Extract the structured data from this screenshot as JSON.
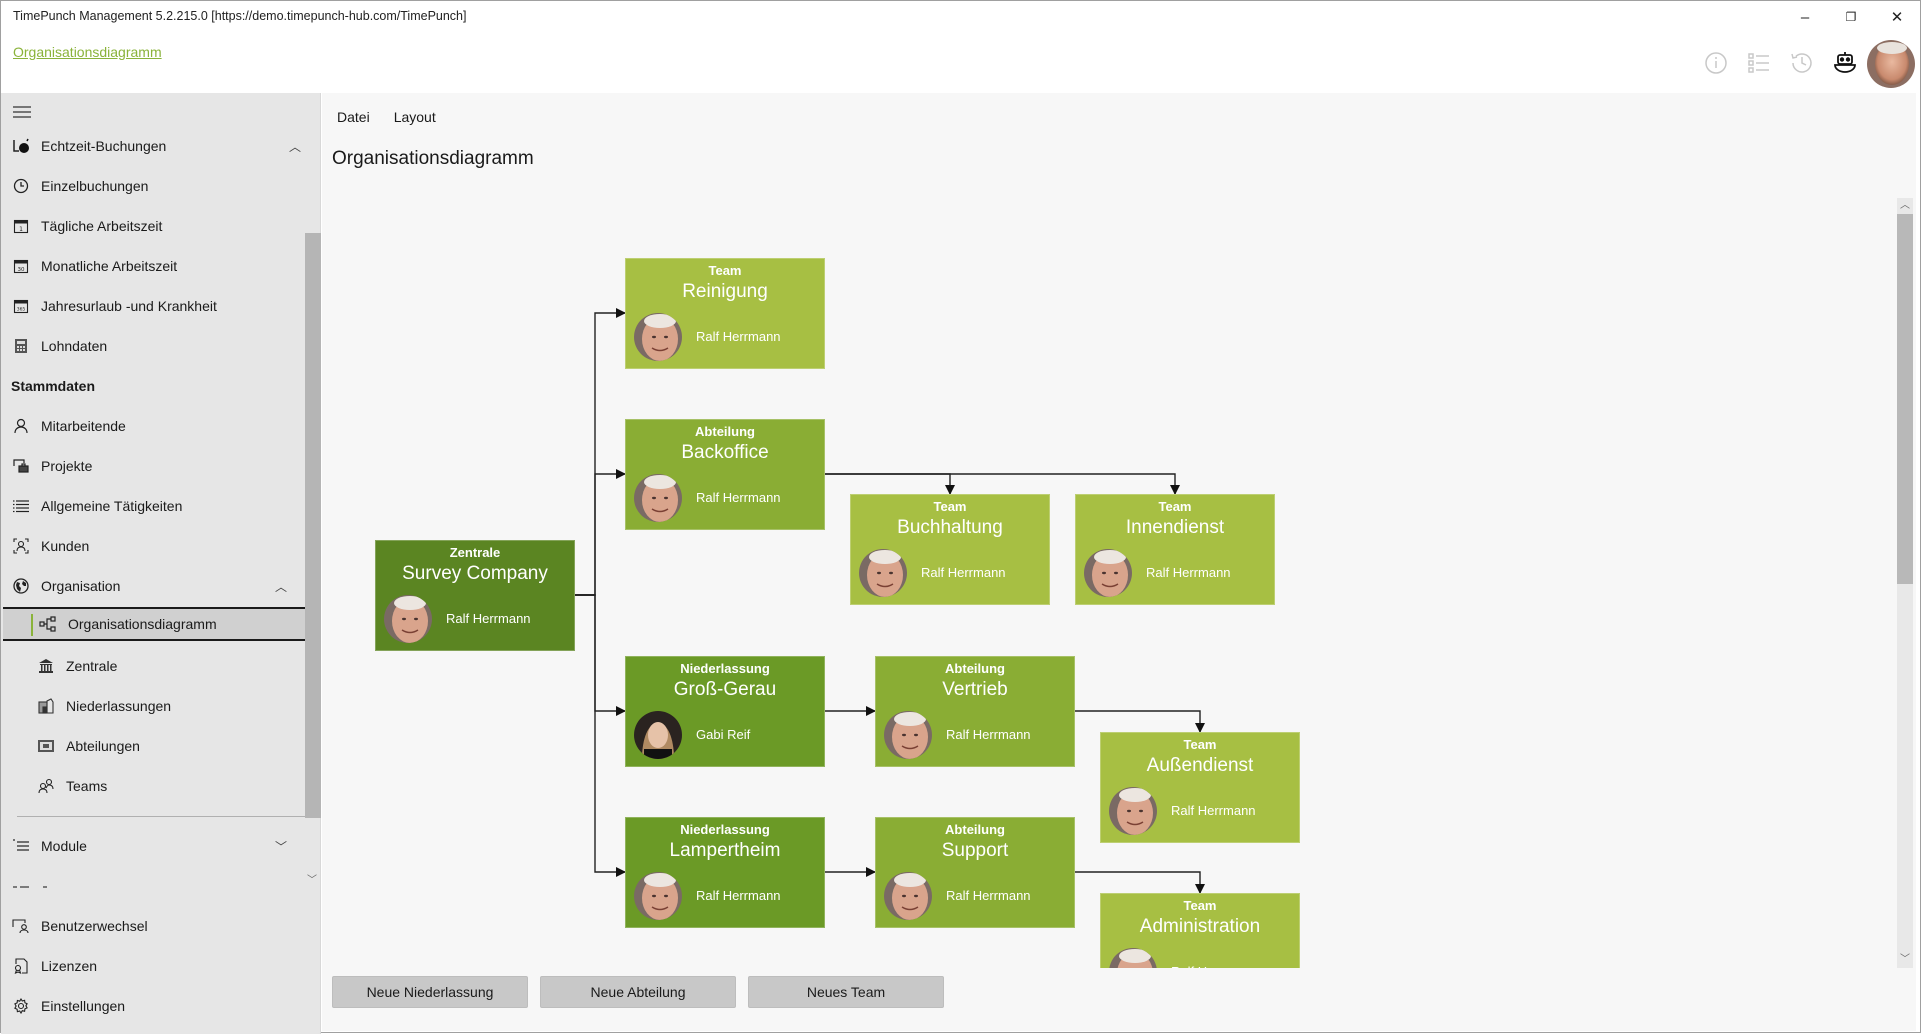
{
  "window": {
    "title": "TimePunch Management 5.2.215.0 [https://demo.timepunch-hub.com/TimePunch]",
    "controls": {
      "minimize": "–",
      "restore": "❐",
      "close": "✕"
    }
  },
  "header": {
    "breadcrumb": "Organisationsdiagramm",
    "accent_color": "#8ab33a",
    "icons": [
      "info-icon",
      "list-icon",
      "history-icon",
      "bot-icon",
      "user-avatar"
    ]
  },
  "sidebar": {
    "menu_icon": "hamburger-icon",
    "items": [
      {
        "label": "Echtzeit-Buchungen",
        "icon": "realtime-booking-icon",
        "chevron": "up"
      },
      {
        "label": "Einzelbuchungen",
        "icon": "clock-icon"
      },
      {
        "label": "Tägliche Arbeitszeit",
        "icon": "calendar-day-icon",
        "icon_text": "1"
      },
      {
        "label": "Monatliche Arbeitszeit",
        "icon": "calendar-month-icon",
        "icon_text": "30"
      },
      {
        "label": "Jahresurlaub -und Krankheit",
        "icon": "calendar-year-icon",
        "icon_text": "365"
      },
      {
        "label": "Lohndaten",
        "icon": "calculator-icon"
      }
    ],
    "section_stammdaten": "Stammdaten",
    "stammdaten_items": [
      {
        "label": "Mitarbeitende",
        "icon": "person-icon"
      },
      {
        "label": "Projekte",
        "icon": "projects-icon"
      },
      {
        "label": "Allgemeine Tätigkeiten",
        "icon": "list-icon"
      },
      {
        "label": "Kunden",
        "icon": "customer-icon"
      },
      {
        "label": "Organisation",
        "icon": "globe-icon",
        "chevron": "up"
      }
    ],
    "organisation_sub": [
      {
        "label": "Organisationsdiagramm",
        "icon": "org-chart-icon",
        "active": true
      },
      {
        "label": "Zentrale",
        "icon": "bank-icon"
      },
      {
        "label": "Niederlassungen",
        "icon": "building-icon"
      },
      {
        "label": "Abteilungen",
        "icon": "department-icon"
      },
      {
        "label": "Teams",
        "icon": "team-icon"
      }
    ],
    "module": {
      "label": "Module",
      "icon": "module-list-icon",
      "chevron": "down"
    },
    "bottom_items": [
      {
        "label": "Benutzerwechsel",
        "icon": "switch-user-icon"
      },
      {
        "label": "Lizenzen",
        "icon": "license-icon"
      },
      {
        "label": "Einstellungen",
        "icon": "gear-icon"
      }
    ]
  },
  "main": {
    "menu": [
      "Datei",
      "Layout"
    ],
    "title": "Organisationsdiagramm",
    "buttons": [
      "Neue Niederlassung",
      "Neue Abteilung",
      "Neues Team"
    ]
  },
  "orgchart": {
    "colors": {
      "zentrale": "#5b8522",
      "niederlassung": "#6b9a26",
      "abteilung": "#8aad34",
      "team": "#a7bf43"
    },
    "nodes": [
      {
        "id": "survey",
        "type": "Zentrale",
        "name": "Survey Company",
        "person": "Ralf Herrmann",
        "level": 0
      },
      {
        "id": "reinigung",
        "type": "Team",
        "name": "Reinigung",
        "person": "Ralf Herrmann",
        "level": 3,
        "parent": "survey"
      },
      {
        "id": "backoffice",
        "type": "Abteilung",
        "name": "Backoffice",
        "person": "Ralf Herrmann",
        "level": 2,
        "parent": "survey"
      },
      {
        "id": "buchhaltung",
        "type": "Team",
        "name": "Buchhaltung",
        "person": "Ralf Herrmann",
        "level": 3,
        "parent": "backoffice"
      },
      {
        "id": "innendienst",
        "type": "Team",
        "name": "Innendienst",
        "person": "Ralf Herrmann",
        "level": 3,
        "parent": "backoffice"
      },
      {
        "id": "grossgerau",
        "type": "Niederlassung",
        "name": "Groß-Gerau",
        "person": "Gabi Reif",
        "level": 1,
        "parent": "survey"
      },
      {
        "id": "vertrieb",
        "type": "Abteilung",
        "name": "Vertrieb",
        "person": "Ralf Herrmann",
        "level": 2,
        "parent": "grossgerau"
      },
      {
        "id": "aussendienst",
        "type": "Team",
        "name": "Außendienst",
        "person": "Ralf Herrmann",
        "level": 3,
        "parent": "vertrieb"
      },
      {
        "id": "lampertheim",
        "type": "Niederlassung",
        "name": "Lampertheim",
        "person": "Ralf Herrmann",
        "level": 1,
        "parent": "survey"
      },
      {
        "id": "support",
        "type": "Abteilung",
        "name": "Support",
        "person": "Ralf Herrmann",
        "level": 2,
        "parent": "lampertheim"
      },
      {
        "id": "administration",
        "type": "Team",
        "name": "Administration",
        "person": "Ralf Herrmann",
        "level": 3,
        "parent": "support"
      }
    ]
  }
}
